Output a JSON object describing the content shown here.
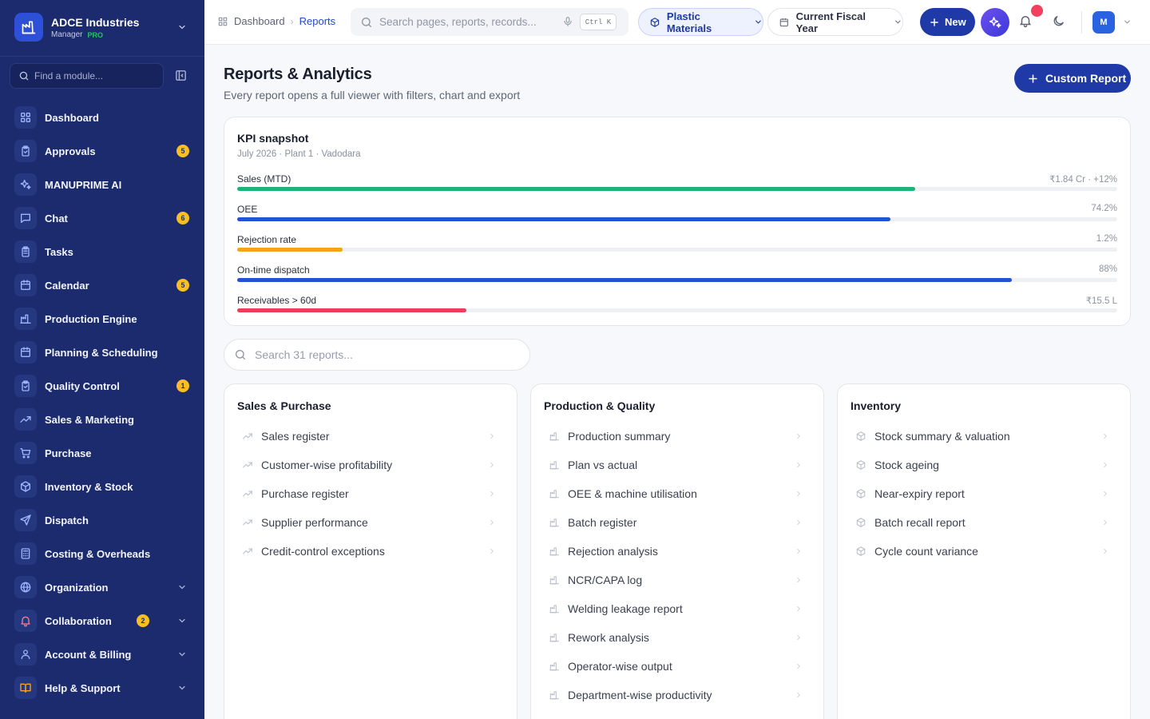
{
  "brand": {
    "name": "ADCE Industries",
    "role": "Manager",
    "plan": "PRO"
  },
  "sidebar": {
    "search_placeholder": "Find a module...",
    "items": [
      {
        "label": "Dashboard",
        "icon": "grid-icon"
      },
      {
        "label": "Approvals",
        "icon": "clipboard-check-icon",
        "badge": "5"
      },
      {
        "label": "MANUPRIME AI",
        "icon": "sparkles-icon"
      },
      {
        "label": "Chat",
        "icon": "chat-icon",
        "badge": "6"
      },
      {
        "label": "Tasks",
        "icon": "clipboard-list-icon"
      },
      {
        "label": "Calendar",
        "icon": "calendar-icon",
        "badge": "5"
      },
      {
        "label": "Production Engine",
        "icon": "factory-icon"
      },
      {
        "label": "Planning & Scheduling",
        "icon": "calendar-icon"
      },
      {
        "label": "Quality Control",
        "icon": "clipboard-check-icon",
        "badge": "1"
      },
      {
        "label": "Sales & Marketing",
        "icon": "trending-up-icon"
      },
      {
        "label": "Purchase",
        "icon": "cart-icon"
      },
      {
        "label": "Inventory & Stock",
        "icon": "box-icon"
      },
      {
        "label": "Dispatch",
        "icon": "send-icon"
      },
      {
        "label": "Costing & Overheads",
        "icon": "calculator-icon"
      },
      {
        "label": "Organization",
        "icon": "globe-icon",
        "expandable": true
      },
      {
        "label": "Collaboration",
        "icon": "bell-icon",
        "badge": "2",
        "expandable": true
      },
      {
        "label": "Account & Billing",
        "icon": "user-icon",
        "expandable": true
      },
      {
        "label": "Help & Support",
        "icon": "book-icon",
        "expandable": true
      }
    ]
  },
  "topbar": {
    "breadcrumb": {
      "home": "Dashboard",
      "current": "Reports"
    },
    "search_placeholder": "Search pages, reports, records...",
    "shortcut": "Ctrl K",
    "material": "Plastic Materials",
    "period": "Current Fiscal Year",
    "new_label": "New",
    "avatar_initial": "M"
  },
  "page": {
    "title": "Reports & Analytics",
    "subtitle": "Every report opens a full viewer with filters, chart and export",
    "custom_report_label": "Custom Report"
  },
  "kpi": {
    "title": "KPI snapshot",
    "subtitle": "July 2026 · Plant 1 · Vadodara",
    "rows": [
      {
        "label": "Sales (MTD)",
        "value": "₹1.84 Cr · +12%",
        "level": 0.77,
        "color": "#1db47a"
      },
      {
        "label": "OEE",
        "value": "74.2%",
        "level": 0.742,
        "color": "#2451d6"
      },
      {
        "label": "Rejection rate",
        "value": "1.2%",
        "level": 0.12,
        "color": "#f2a516"
      },
      {
        "label": "On-time dispatch",
        "value": "88%",
        "level": 0.88,
        "color": "#2451d6"
      },
      {
        "label": "Receivables > 60d",
        "value": "₹15.5 L",
        "level": 0.26,
        "color": "#ec3d59"
      }
    ]
  },
  "report_search_placeholder": "Search 31 reports...",
  "categories": [
    {
      "title": "Sales & Purchase",
      "icon": "trending-up-icon",
      "items": [
        "Sales register",
        "Customer-wise profitability",
        "Purchase register",
        "Supplier performance",
        "Credit-control exceptions"
      ]
    },
    {
      "title": "Production & Quality",
      "icon": "factory-icon",
      "items": [
        "Production summary",
        "Plan vs actual",
        "OEE & machine utilisation",
        "Batch register",
        "Rejection analysis",
        "NCR/CAPA log",
        "Welding leakage report",
        "Rework analysis",
        "Operator-wise output",
        "Department-wise productivity"
      ]
    },
    {
      "title": "Inventory",
      "icon": "box-icon",
      "items": [
        "Stock summary & valuation",
        "Stock ageing",
        "Near-expiry report",
        "Batch recall report",
        "Cycle count variance"
      ]
    }
  ]
}
